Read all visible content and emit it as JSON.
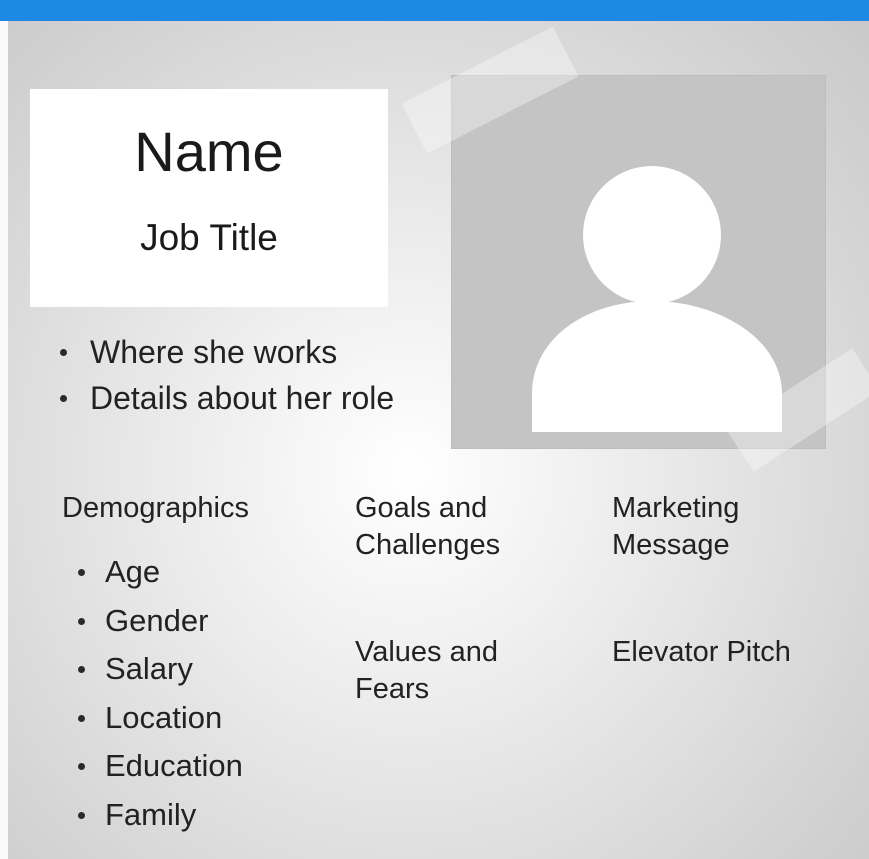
{
  "header": {
    "accent_color": "#1e88e5"
  },
  "profile": {
    "name": "Name",
    "job_title": "Job Title",
    "photo_icon": "person-avatar-icon",
    "role_details": [
      "Where she works",
      "Details about her role"
    ]
  },
  "sections": {
    "demographics": {
      "heading": "Demographics",
      "items": [
        "Age",
        "Gender",
        "Salary",
        "Location",
        "Education",
        "Family"
      ]
    },
    "goals": {
      "heading_line1": "Goals and",
      "heading_line2": "Challenges"
    },
    "values": {
      "heading_line1": "Values and",
      "heading_line2": "Fears"
    },
    "marketing": {
      "heading_line1": "Marketing",
      "heading_line2": "Message"
    },
    "pitch": {
      "heading": "Elevator Pitch"
    }
  }
}
